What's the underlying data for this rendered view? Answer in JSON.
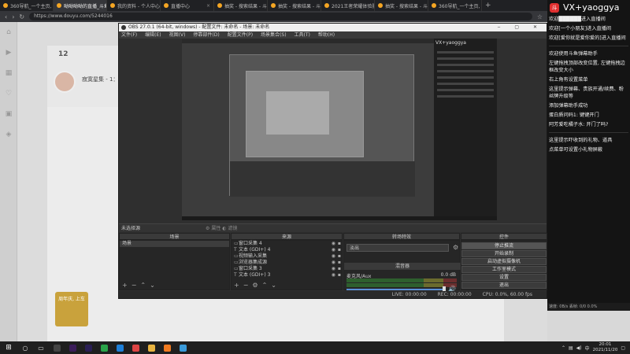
{
  "browser": {
    "tabs": [
      {
        "label": "360导航_一个主页, 整个",
        "active": false
      },
      {
        "label": "呦呦呦呦的直播_斗鱼在",
        "active": true
      },
      {
        "label": "我的资料 - 个人中心 - 斗鱼",
        "active": false
      },
      {
        "label": "直播中心",
        "active": false
      },
      {
        "label": "抽奖 - 搜索结果 - 斗鱼直播",
        "active": false
      },
      {
        "label": "抽奖 - 搜索结果 - 斗鱼直播",
        "active": false
      },
      {
        "label": "2021王者荣耀体验服",
        "active": false
      },
      {
        "label": "抽奖 - 搜索结果 - 斗鱼直播",
        "active": false
      },
      {
        "label": "360导航_一个主页, 整个",
        "active": false
      }
    ],
    "url": "https://www.douyu.com/5244016"
  },
  "douyu": {
    "follow_count": "12",
    "anchor_title": "寂寞星集 - 1：",
    "promo": "周年庆, 上车"
  },
  "obs": {
    "title": "OBS 27.0.1 (64-bit, windows) - 配置文件: 未命名 - 场景: 未命名",
    "menu": [
      "文件(F)",
      "编辑(E)",
      "视图(V)",
      "停靠部件(D)",
      "配置文件(P)",
      "场景集合(S)",
      "工具(T)",
      "帮助(H)"
    ],
    "nested_chat_title": "VX+yaoggya",
    "scene_bar_label": "未选择源",
    "scene_bar_tools": [
      "属性",
      "滤镜"
    ],
    "docks": {
      "scenes_title": "场景",
      "sources_title": "来源",
      "transitions_title": "转场特效",
      "mixer_title": "混音器",
      "controls_title": "控件"
    },
    "scenes": [
      "场景"
    ],
    "sources": [
      {
        "icon": "▭",
        "label": "窗口采集 4"
      },
      {
        "icon": "T",
        "label": "文本 (GDI+) 4"
      },
      {
        "icon": "▭",
        "label": "视频输入采集"
      },
      {
        "icon": "▭",
        "label": "浏览器集成源"
      },
      {
        "icon": "▭",
        "label": "窗口采集 3"
      },
      {
        "icon": "T",
        "label": "文本 (GDI+) 3"
      }
    ],
    "transition": "淡出",
    "mixer": {
      "channel": "麦克风/Aux",
      "db": "0.0 dB"
    },
    "controls": [
      {
        "label": "停止推流",
        "active": true
      },
      {
        "label": "开始录制",
        "active": false
      },
      {
        "label": "启动虚拟摄像机",
        "active": false
      },
      {
        "label": "工作室模式",
        "active": false
      },
      {
        "label": "设置",
        "active": false
      },
      {
        "label": "退出",
        "active": false
      }
    ],
    "status": {
      "live": "LIVE: 00:00:00",
      "rec": "REC: 00:00:00",
      "cpu": "CPU: 0.0%, 60.00 fps"
    }
  },
  "chat": {
    "title": "VX+yaoggya",
    "messages": [
      "欢迎██████进入直播间",
      "欢迎[一个小朋友]进入直播间",
      "欢迎[爱你就是爱你爱的]进入直播间",
      "欢迎使用斗鱼弹幕助手",
      "左键拖拽顶部改变位置, 左键拖拽边框改变大小",
      "右上角有设置菜单",
      "这里提示弹幕、贵族开通/续费、粉丝牌升级等",
      "添加弹幕助手成功",
      "蛋白质问码1: 键键开门",
      "阿芳爱吃橘子水: 开门了吗?",
      "这里提示吓收到的礼物、道具",
      "点菜单可设置小礼物屏蔽"
    ],
    "stat": "速度: 0B/s 丢帧: 0/0 0.0%"
  },
  "taskbar": {
    "time": "20:01",
    "date": "2021/11/20",
    "icons": [
      {
        "name": "obs",
        "color": "#444"
      },
      {
        "name": "premiere",
        "color": "#3b1d5a"
      },
      {
        "name": "aftereffects",
        "color": "#2a1f55"
      },
      {
        "name": "browser-360",
        "color": "#2aa34a"
      },
      {
        "name": "edge",
        "color": "#1e7fd8"
      },
      {
        "name": "chrome",
        "color": "#d44"
      },
      {
        "name": "folder",
        "color": "#e8b340"
      },
      {
        "name": "douyu",
        "color": "#f07a20"
      },
      {
        "name": "video",
        "color": "#3a9ad9"
      }
    ]
  }
}
